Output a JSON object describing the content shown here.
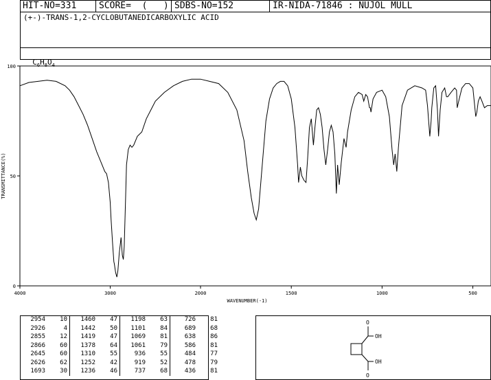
{
  "header": {
    "hit": "HIT-NO=331",
    "score": "SCORE=  (   )",
    "sdbs": "SDBS-NO=152",
    "ir": "IR-NIDA-71846 : NUJOL MULL"
  },
  "compound_name": "(+-)-TRANS-1,2-CYCLOBUTANEDICARBOXYLIC ACID",
  "formula": {
    "c": "C",
    "n1": "6",
    "h": "H",
    "n2": "8",
    "o": "O",
    "n3": "4"
  },
  "structure": {
    "o_top": "O",
    "oh_top": "OH",
    "o_bottom": "O",
    "oh_bottom": "OH"
  },
  "chart_data": {
    "type": "line",
    "xlabel": "WAVENUMBER(-1)",
    "ylabel": "TRANSMITTANCE(%)",
    "xlim": [
      4000,
      400
    ],
    "ylim": [
      0,
      100
    ],
    "x_ticks": [
      4000,
      3000,
      2000,
      1500,
      1000,
      500
    ],
    "y_ticks": [
      0,
      50,
      100
    ],
    "series": [
      {
        "points": [
          [
            4000,
            91
          ],
          [
            3900,
            92.5
          ],
          [
            3800,
            93
          ],
          [
            3700,
            93.5
          ],
          [
            3600,
            93
          ],
          [
            3500,
            91
          ],
          [
            3450,
            89
          ],
          [
            3400,
            86
          ],
          [
            3350,
            82
          ],
          [
            3300,
            78
          ],
          [
            3250,
            73
          ],
          [
            3200,
            67
          ],
          [
            3150,
            61
          ],
          [
            3100,
            56
          ],
          [
            3060,
            52
          ],
          [
            3040,
            51
          ],
          [
            3020,
            47
          ],
          [
            3000,
            38
          ],
          [
            2990,
            30
          ],
          [
            2975,
            20
          ],
          [
            2960,
            11
          ],
          [
            2954,
            10
          ],
          [
            2940,
            6
          ],
          [
            2926,
            4
          ],
          [
            2915,
            7
          ],
          [
            2900,
            15
          ],
          [
            2880,
            22
          ],
          [
            2866,
            14
          ],
          [
            2855,
            12
          ],
          [
            2845,
            18
          ],
          [
            2830,
            40
          ],
          [
            2820,
            55
          ],
          [
            2800,
            62
          ],
          [
            2780,
            64
          ],
          [
            2760,
            63
          ],
          [
            2740,
            64
          ],
          [
            2700,
            68
          ],
          [
            2650,
            70
          ],
          [
            2600,
            76
          ],
          [
            2550,
            80
          ],
          [
            2500,
            84
          ],
          [
            2400,
            88
          ],
          [
            2300,
            91
          ],
          [
            2200,
            93
          ],
          [
            2100,
            94
          ],
          [
            2000,
            94
          ],
          [
            1950,
            93
          ],
          [
            1900,
            92
          ],
          [
            1850,
            88
          ],
          [
            1800,
            80
          ],
          [
            1760,
            66
          ],
          [
            1740,
            52
          ],
          [
            1720,
            40
          ],
          [
            1705,
            33
          ],
          [
            1693,
            30
          ],
          [
            1680,
            35
          ],
          [
            1660,
            55
          ],
          [
            1640,
            75
          ],
          [
            1620,
            85
          ],
          [
            1600,
            90
          ],
          [
            1580,
            92
          ],
          [
            1560,
            93
          ],
          [
            1540,
            93
          ],
          [
            1520,
            91
          ],
          [
            1500,
            85
          ],
          [
            1480,
            72
          ],
          [
            1465,
            55
          ],
          [
            1460,
            47
          ],
          [
            1450,
            54
          ],
          [
            1442,
            50
          ],
          [
            1430,
            48
          ],
          [
            1419,
            47
          ],
          [
            1410,
            58
          ],
          [
            1400,
            72
          ],
          [
            1390,
            76
          ],
          [
            1378,
            64
          ],
          [
            1370,
            72
          ],
          [
            1360,
            80
          ],
          [
            1350,
            81
          ],
          [
            1340,
            78
          ],
          [
            1330,
            72
          ],
          [
            1320,
            62
          ],
          [
            1310,
            55
          ],
          [
            1300,
            62
          ],
          [
            1290,
            70
          ],
          [
            1280,
            73
          ],
          [
            1270,
            70
          ],
          [
            1260,
            60
          ],
          [
            1252,
            42
          ],
          [
            1245,
            55
          ],
          [
            1236,
            46
          ],
          [
            1225,
            56
          ],
          [
            1210,
            67
          ],
          [
            1198,
            63
          ],
          [
            1190,
            70
          ],
          [
            1170,
            80
          ],
          [
            1150,
            86
          ],
          [
            1130,
            88
          ],
          [
            1110,
            87
          ],
          [
            1101,
            84
          ],
          [
            1090,
            87
          ],
          [
            1080,
            86
          ],
          [
            1069,
            81
          ],
          [
            1065,
            81
          ],
          [
            1061,
            79
          ],
          [
            1050,
            85
          ],
          [
            1030,
            88
          ],
          [
            1000,
            89
          ],
          [
            980,
            86
          ],
          [
            960,
            77
          ],
          [
            945,
            62
          ],
          [
            936,
            55
          ],
          [
            928,
            60
          ],
          [
            919,
            52
          ],
          [
            910,
            63
          ],
          [
            890,
            82
          ],
          [
            860,
            89
          ],
          [
            820,
            91
          ],
          [
            780,
            90
          ],
          [
            760,
            89
          ],
          [
            750,
            82
          ],
          [
            737,
            68
          ],
          [
            730,
            75
          ],
          [
            726,
            81
          ],
          [
            715,
            90
          ],
          [
            705,
            91
          ],
          [
            695,
            80
          ],
          [
            689,
            68
          ],
          [
            680,
            80
          ],
          [
            670,
            88
          ],
          [
            655,
            90
          ],
          [
            645,
            86
          ],
          [
            638,
            86
          ],
          [
            620,
            88
          ],
          [
            600,
            90
          ],
          [
            590,
            89
          ],
          [
            586,
            81
          ],
          [
            575,
            85
          ],
          [
            560,
            90
          ],
          [
            540,
            92
          ],
          [
            520,
            92
          ],
          [
            500,
            90
          ],
          [
            484,
            77
          ],
          [
            478,
            79
          ],
          [
            470,
            84
          ],
          [
            460,
            86
          ],
          [
            450,
            84
          ],
          [
            436,
            81
          ],
          [
            420,
            82
          ],
          [
            400,
            82
          ]
        ]
      }
    ]
  },
  "peaks": [
    [
      "2954",
      "10",
      "1460",
      "47",
      "1198",
      "63",
      "726",
      "81"
    ],
    [
      "2926",
      "4",
      "1442",
      "50",
      "1101",
      "84",
      "689",
      "68"
    ],
    [
      "2855",
      "12",
      "1419",
      "47",
      "1069",
      "81",
      "638",
      "86"
    ],
    [
      "2866",
      "60",
      "1378",
      "64",
      "1061",
      "79",
      "586",
      "81"
    ],
    [
      "2645",
      "60",
      "1310",
      "55",
      "936",
      "55",
      "484",
      "77"
    ],
    [
      "2626",
      "62",
      "1252",
      "42",
      "919",
      "52",
      "478",
      "79"
    ],
    [
      "1693",
      "30",
      "1236",
      "46",
      "737",
      "68",
      "436",
      "81"
    ]
  ]
}
